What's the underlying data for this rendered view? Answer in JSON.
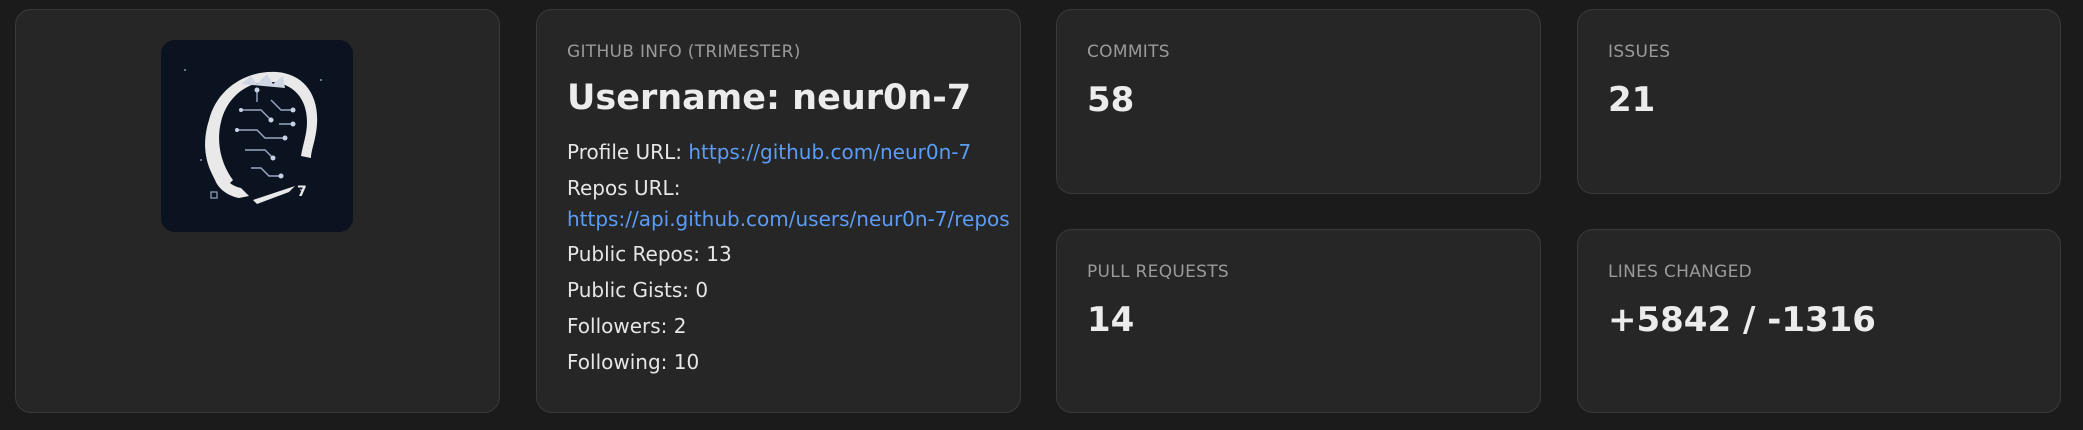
{
  "avatar": {
    "icon": "ai-head-avatar",
    "badge_text": "7",
    "background": "#0b1220"
  },
  "github_info": {
    "label": "GITHUB INFO (TRIMESTER)",
    "username_text": "Username: neur0n-7",
    "profile_url_label": "Profile URL:",
    "profile_url": "https://github.com/neur0n-7",
    "repos_url_label": "Repos URL:",
    "repos_url": "https://api.github.com/users/neur0n-7/repos",
    "public_repos": "Public Repos: 13",
    "public_gists": "Public Gists: 0",
    "followers": "Followers: 2",
    "following": "Following: 10"
  },
  "stats": {
    "commits": {
      "label": "COMMITS",
      "value": "58"
    },
    "issues": {
      "label": "ISSUES",
      "value": "21"
    },
    "pull_requests": {
      "label": "PULL REQUESTS",
      "value": "14"
    },
    "lines_changed": {
      "label": "LINES CHANGED",
      "value": "+5842 / -1316"
    }
  },
  "colors": {
    "background": "#1b1b1b",
    "card": "#262626",
    "link": "#5b9cf6",
    "label": "#9a9a9a"
  }
}
